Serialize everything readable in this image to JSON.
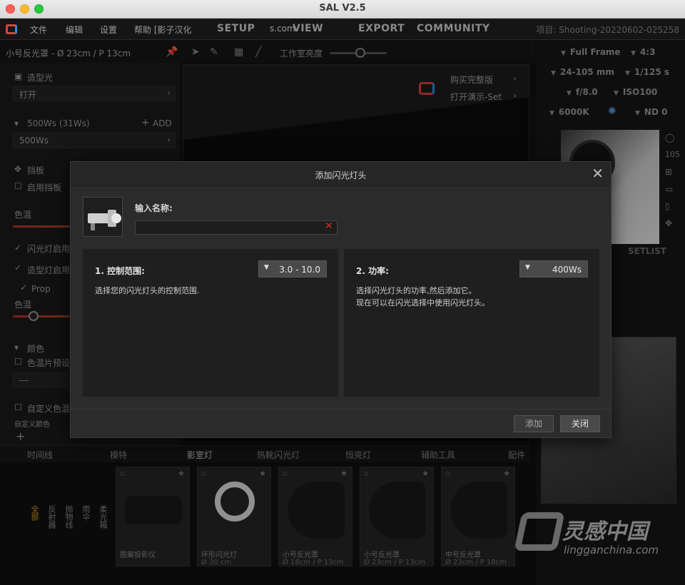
{
  "window": {
    "title": "SAL V2.5"
  },
  "menubar": {
    "items": [
      "文件",
      "编辑",
      "设置",
      "帮助 [影子汉化"
    ],
    "nav": [
      "SETUP",
      "VIEW",
      "EXPORT",
      "COMMUNITY"
    ],
    "nav_partial": "s.com",
    "project": "项目: Shooting-20220602-025258"
  },
  "toolbar": {
    "flash_title": "小号反光罩 - Ø 23cm / P 13cm",
    "studio_brightness_label": "工作室亮度",
    "studio_brightness": 0.5
  },
  "left_panel": {
    "modeling_light": "造型光",
    "modeling_value": "打开",
    "power_label": "500Ws (31Ws)",
    "add_label": "ADD",
    "power_value": "500Ws",
    "flag_label": "挡板",
    "enable_flag": "启用挡板",
    "color_temp": "色温",
    "flash_enabled": "闪光灯启用",
    "modeling_enabled": "造型灯启用",
    "prop": "Prop",
    "color_temp2": "色温",
    "color": "颜色",
    "gel_preset": "色温片预设",
    "dashes": "---",
    "custom_temp": "自定义色温",
    "custom_color": "自定义颜色"
  },
  "viewport": {
    "buy_full": "购买完整版",
    "open_demo": "打开演示-Set"
  },
  "camera": {
    "frame": "Full Frame",
    "ratio": "4:3",
    "lens": "24-105 mm",
    "shutter": "1/125 s",
    "aperture": "f/8.0",
    "iso": "ISO100",
    "wb": "6000K",
    "nd": "ND 0",
    "setlist": "SETLIST",
    "side_number": "105"
  },
  "bottom_tabs": [
    "时间线",
    "模特",
    "影室灯",
    "热靴闪光灯",
    "恒亮灯",
    "辅助工具",
    "配件"
  ],
  "bottom_tabs_active": 2,
  "library_categories": [
    "全部",
    "反射器",
    "抛物线",
    "雨伞",
    "柔光箱"
  ],
  "library_active": 0,
  "library_items": [
    {
      "name": "图案投影仪",
      "size": ""
    },
    {
      "name": "环形闪光灯",
      "size": "Ø 30 cm"
    },
    {
      "name": "小号反光罩",
      "size": "Ø 18cm / P 13cm"
    },
    {
      "name": "小号反光罩",
      "size": "Ø 23cm / P 13cm"
    },
    {
      "name": "中号反光罩",
      "size": "Ø 23cm / P 18cm"
    }
  ],
  "dialog": {
    "title": "添加闪光灯头",
    "name_label": "输入名称:",
    "name_value": "",
    "range": {
      "title": "1. 控制范围:",
      "value": "3.0 - 10.0",
      "desc": "选择您的闪光灯头的控制范围."
    },
    "power": {
      "title": "2. 功率:",
      "value": "400Ws",
      "desc_line1": "选择闪光灯头的功率,然后添加它。",
      "desc_line2": "现在可以在闪光选择中使用闪光灯头。"
    },
    "add_button": "添加",
    "close_button": "关闭"
  },
  "watermark": {
    "brand": "灵感中国",
    "domain": "lingganchina.com"
  }
}
